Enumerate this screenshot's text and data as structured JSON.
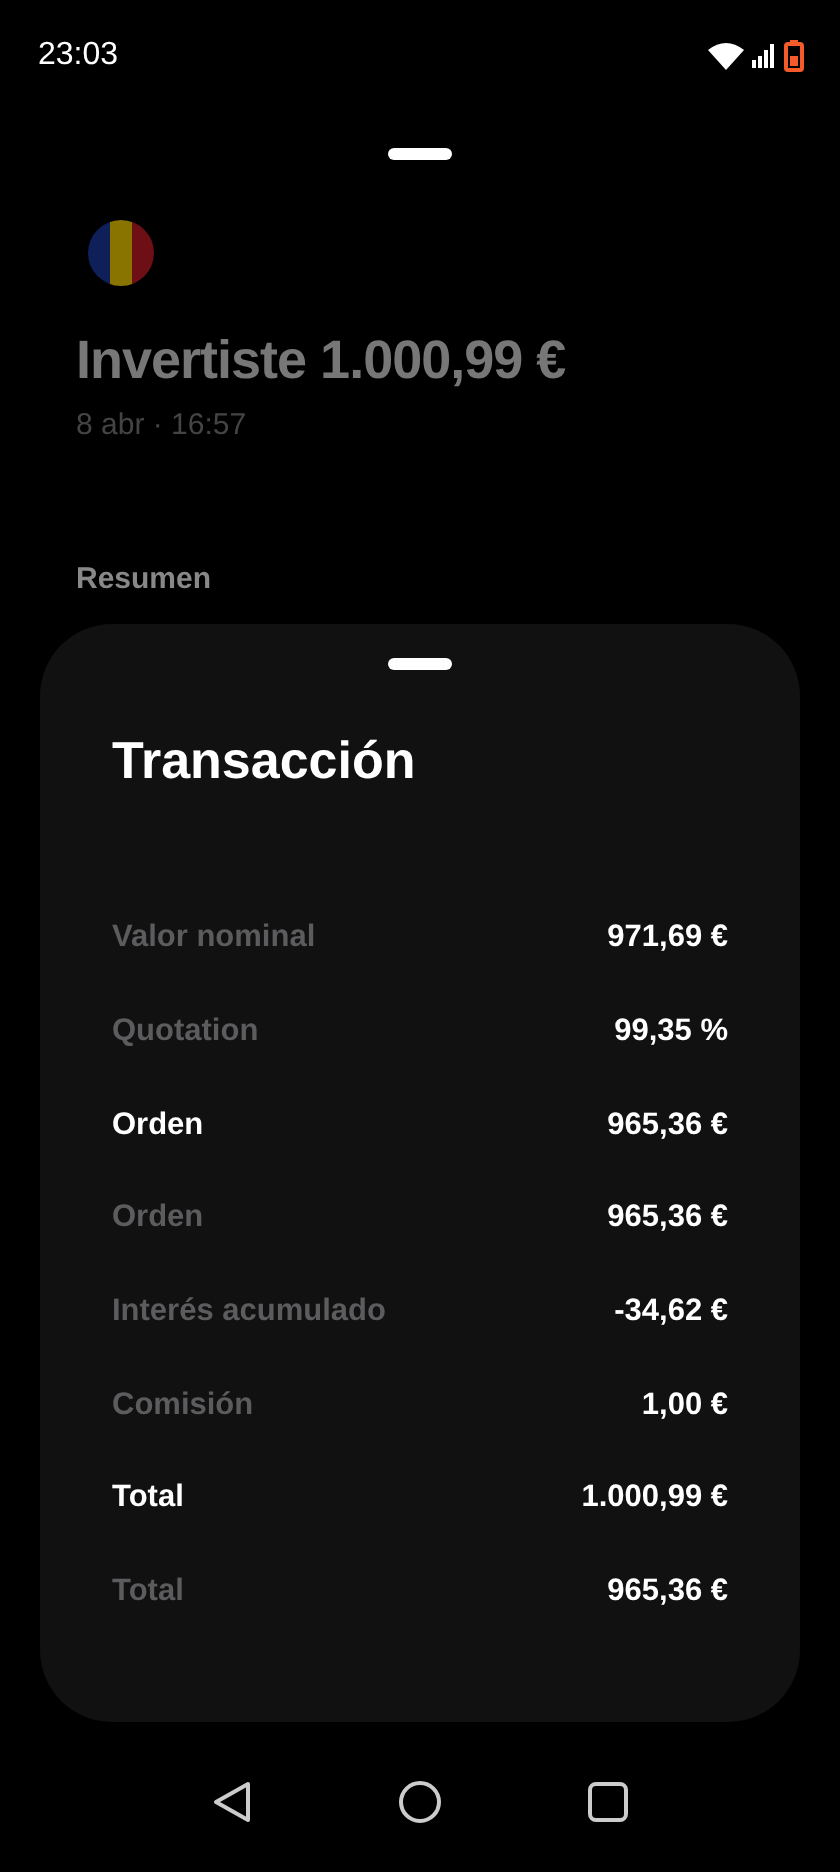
{
  "status_bar": {
    "time": "23:03"
  },
  "header": {
    "title": "Invertiste 1.000,99 €",
    "date": "8 abr · 16:57",
    "section": "Resumen"
  },
  "sheet": {
    "title": "Transacción",
    "rows": [
      {
        "label": "Valor nominal",
        "value": "971,69 €",
        "highlighted": false
      },
      {
        "label": "Quotation",
        "value": "99,35 %",
        "highlighted": false
      },
      {
        "label": "Orden",
        "value": "965,36 €",
        "highlighted": true
      },
      {
        "label": "Orden",
        "value": "965,36 €",
        "highlighted": false
      },
      {
        "label": "Interés acumulado",
        "value": "-34,62 €",
        "highlighted": false
      },
      {
        "label": "Comisión",
        "value": "1,00 €",
        "highlighted": false
      },
      {
        "label": "Total",
        "value": "1.000,99 €",
        "highlighted": true
      },
      {
        "label": "Total",
        "value": "965,36 €",
        "highlighted": false
      }
    ]
  }
}
